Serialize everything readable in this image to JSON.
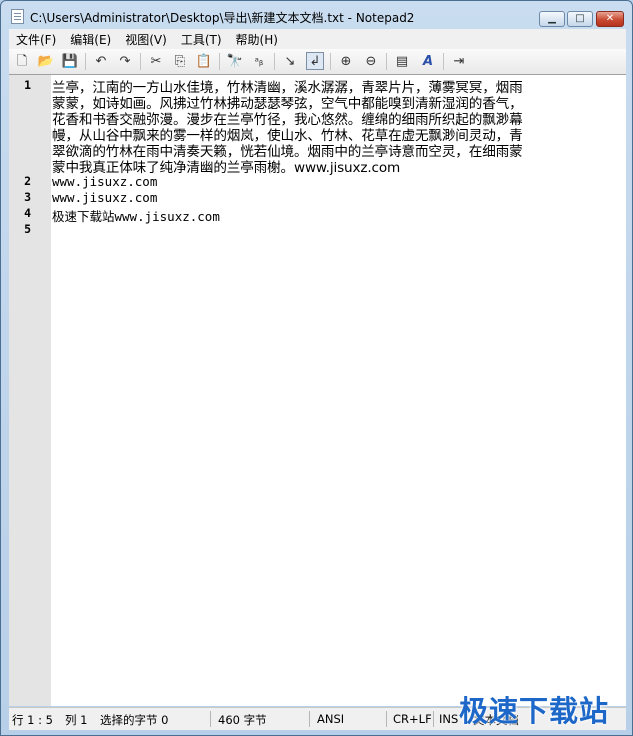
{
  "window": {
    "title": "C:\\Users\\Administrator\\Desktop\\导出\\新建文本文档.txt - Notepad2",
    "minimize_icon": "minimize-icon",
    "maximize_icon": "maximize-icon",
    "close_icon": "close-icon"
  },
  "menu": [
    "文件(F)",
    "编辑(E)",
    "视图(V)",
    "工具(T)",
    "帮助(H)"
  ],
  "toolbar": {
    "icons": [
      {
        "name": "new-file-icon",
        "glyph": "🗋"
      },
      {
        "name": "open-folder-icon",
        "glyph": "📂"
      },
      {
        "name": "save-icon",
        "glyph": "💾"
      },
      {
        "name": "undo-icon",
        "glyph": "↶"
      },
      {
        "name": "redo-icon",
        "glyph": "↷"
      },
      {
        "name": "cut-icon",
        "glyph": "✂"
      },
      {
        "name": "copy-icon",
        "glyph": "⎘"
      },
      {
        "name": "paste-icon",
        "glyph": "📋"
      },
      {
        "name": "find-icon",
        "glyph": "🔭"
      },
      {
        "name": "replace-icon",
        "glyph": "ᵃᵦ"
      },
      {
        "name": "goto-icon",
        "glyph": "↘"
      },
      {
        "name": "word-wrap-icon",
        "glyph": "↲"
      },
      {
        "name": "zoom-in-icon",
        "glyph": "⊕"
      },
      {
        "name": "zoom-out-icon",
        "glyph": "⊖"
      },
      {
        "name": "scheme-icon",
        "glyph": "▤"
      },
      {
        "name": "font-icon",
        "glyph": "A"
      },
      {
        "name": "exit-icon",
        "glyph": "⇥"
      }
    ]
  },
  "editor": {
    "line_numbers": [
      "1",
      "2",
      "3",
      "4",
      "5"
    ],
    "lines": [
      "兰亭，江南的一方山水佳境，竹林清幽，溪水潺潺，青翠片片，薄雾冥冥，烟雨",
      "蒙蒙，如诗如画。风拂过竹林拂动瑟瑟琴弦，空气中都能嗅到清新湿润的香气，",
      "花香和书香交融弥漫。漫步在兰亭竹径，我心悠然。缠绵的细雨所织起的飘渺幕",
      "幔，从山谷中飘来的雾一样的烟岚，使山水、竹林、花草在虚无飘渺间灵动，青",
      "翠欲滴的竹林在雨中清奏天籁，恍若仙境。烟雨中的兰亭诗意而空灵，在细雨蒙",
      "蒙中我真正体味了纯净清幽的兰亭雨榭。www.jisuxz.com",
      "www.jisuxz.com",
      "www.jisuxz.com",
      "极速下载站www.jisuxz.com",
      ""
    ]
  },
  "status": {
    "position": "行 1 : 5",
    "column": "列 1",
    "selected": "选择的字节 0",
    "bytes": "460 字节",
    "encoding": "ANSI",
    "eol": "CR+LF",
    "mode": "INS",
    "filetype": "文本文档"
  },
  "watermark": "极速下载站"
}
